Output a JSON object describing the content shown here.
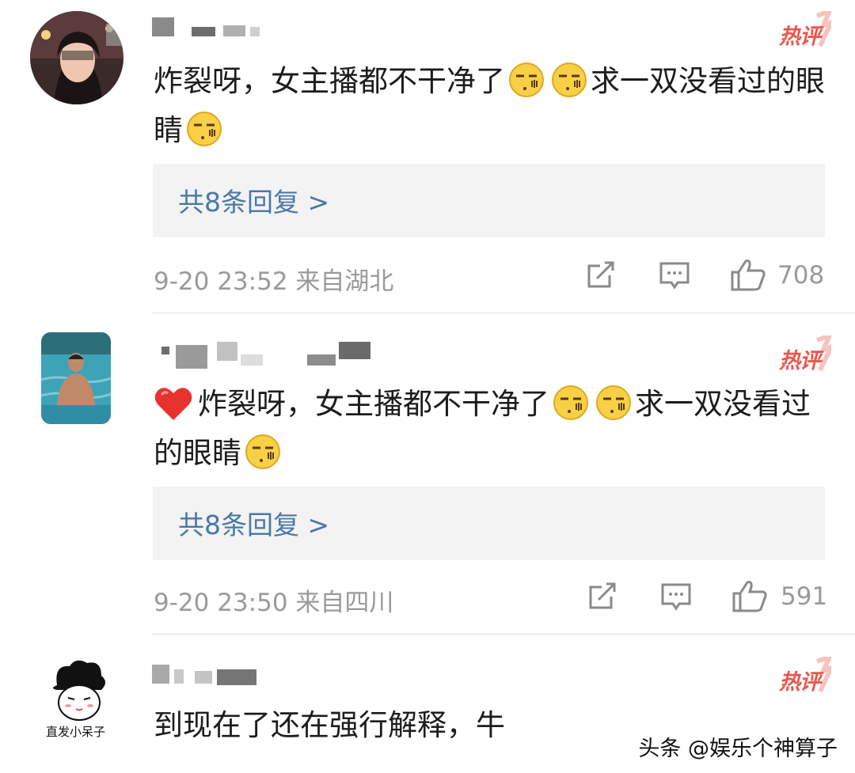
{
  "comments": [
    {
      "badge": "热评",
      "text_parts": [
        "炸裂呀，女主播都不干净了",
        "求一双没看过的眼睛"
      ],
      "replies": "共8条回复 >",
      "meta": "9-20 23:52 来自湖北",
      "likes": "708"
    },
    {
      "badge": "热评",
      "text_parts": [
        "炸裂呀，女主播都不干净了",
        "求一双没看过的眼睛"
      ],
      "replies": "共8条回复 >",
      "meta": "9-20 23:50 来自四川",
      "likes": "591"
    },
    {
      "badge": "热评",
      "text": "到现在了还在强行解释，牛",
      "avatar_caption": "直发小呆子"
    }
  ],
  "watermark": "头条 @娱乐个神算子",
  "colors": {
    "hot": "#e8584f",
    "link": "#4a78a8",
    "meta": "#9a9a9a",
    "reply_bg": "#f3f3f3"
  }
}
